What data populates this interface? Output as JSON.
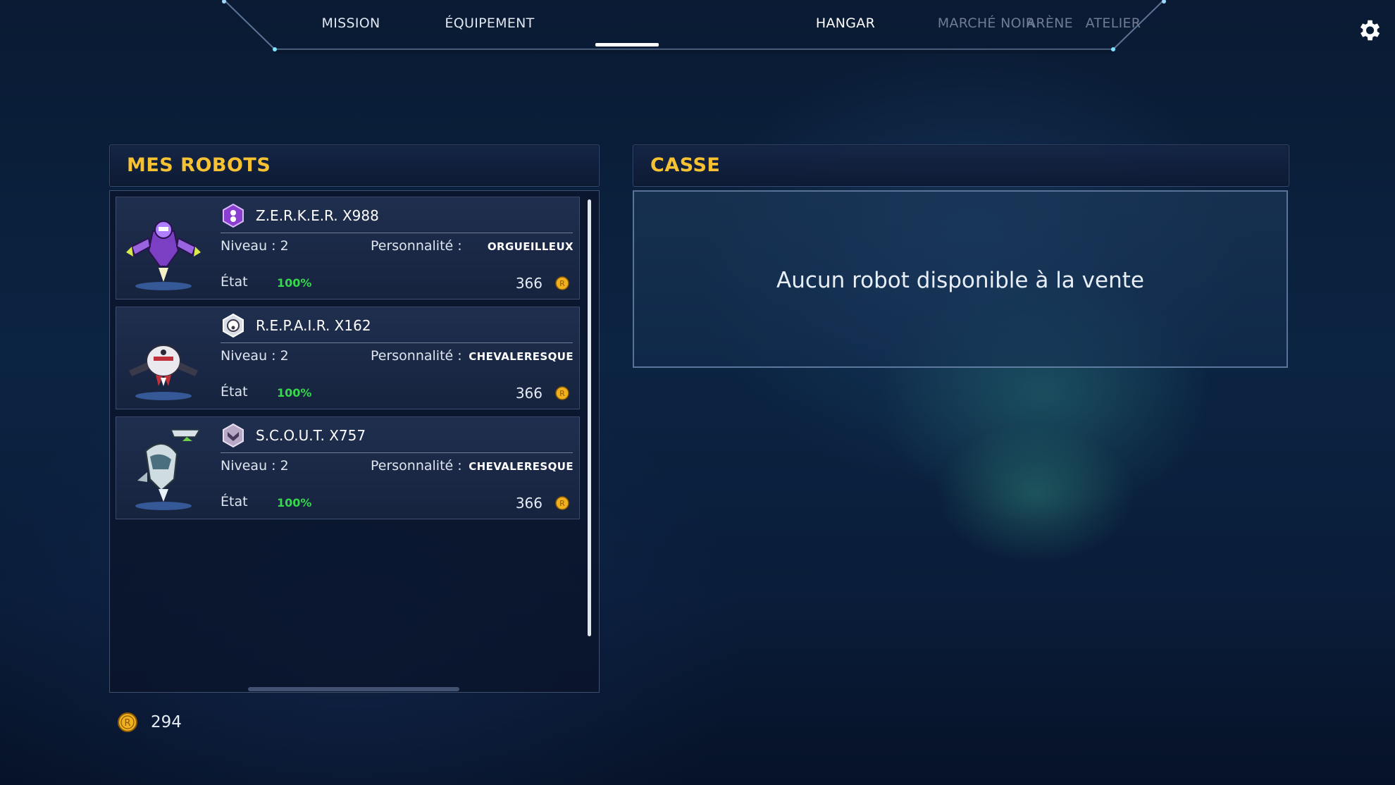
{
  "nav": {
    "tabs": [
      {
        "label": "MISSION",
        "state": "normal"
      },
      {
        "label": "ÉQUIPEMENT",
        "state": "normal"
      },
      {
        "label": "HANGAR",
        "state": "active"
      },
      {
        "label": "MARCHÉ NOIR",
        "state": "dim"
      },
      {
        "label": "ATELIER",
        "state": "dim"
      },
      {
        "label": "ARÈNE",
        "state": "dim"
      }
    ],
    "settings_icon": "gear-icon"
  },
  "robots_panel": {
    "title": "MES ROBOTS",
    "level_label": "Niveau : 2",
    "personality_label": "Personnalité :",
    "state_label": "État",
    "robots": [
      {
        "name": "Z.E.R.K.E.R. X988",
        "personality": "ORGUEILLEUX",
        "state": "100%",
        "price": "366",
        "class_icon": "purple-class-badge-icon"
      },
      {
        "name": "R.E.P.A.I.R. X162",
        "personality": "CHEVALERESQUE",
        "state": "100%",
        "price": "366",
        "class_icon": "white-class-badge-icon"
      },
      {
        "name": "S.C.O.U.T. X757",
        "personality": "CHEVALERESQUE",
        "state": "100%",
        "price": "366",
        "class_icon": "scout-class-badge-icon"
      }
    ]
  },
  "casse_panel": {
    "title": "CASSE",
    "empty_message": "Aucun robot disponible à la vente"
  },
  "wallet": {
    "amount": "294",
    "currency_icon": "coin-icon"
  },
  "colors": {
    "accent_title": "#f6c233",
    "state_ok": "#34d84a",
    "coin": "#f0b020"
  }
}
